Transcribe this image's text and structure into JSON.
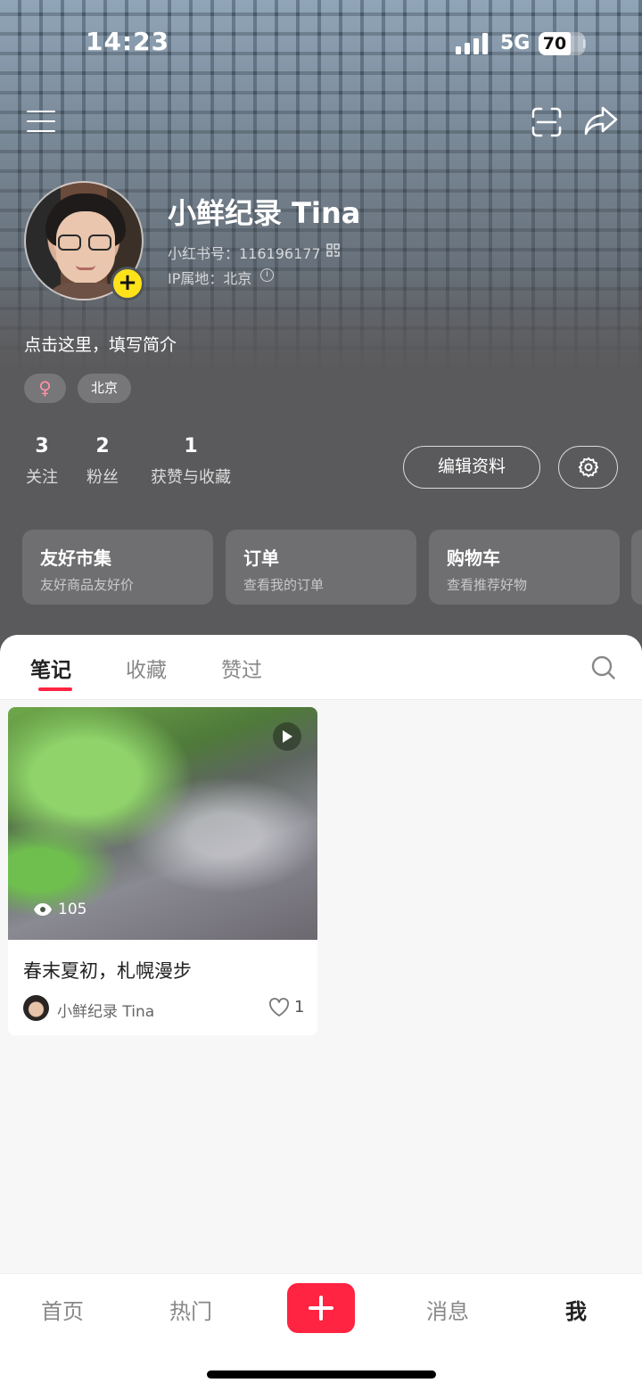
{
  "status_bar": {
    "time": "14:23",
    "network": "5G",
    "battery": "70"
  },
  "profile": {
    "nickname": "小鲜纪录 Tina",
    "redbook_id": "小红书号：116196177",
    "ip_location": "IP属地：北京",
    "bio": "点击这里，填写简介",
    "tags": {
      "gender": "♀",
      "city": "北京"
    }
  },
  "stats": [
    {
      "value": "3",
      "label": "关注"
    },
    {
      "value": "2",
      "label": "粉丝"
    },
    {
      "value": "1",
      "label": "获赞与收藏"
    }
  ],
  "actions": {
    "edit_profile": "编辑资料"
  },
  "services": [
    {
      "title": "友好市集",
      "subtitle": "友好商品友好价"
    },
    {
      "title": "订单",
      "subtitle": "查看我的订单"
    },
    {
      "title": "购物车",
      "subtitle": "查看推荐好物"
    }
  ],
  "tabs": [
    {
      "label": "笔记",
      "active": true
    },
    {
      "label": "收藏",
      "active": false
    },
    {
      "label": "赞过",
      "active": false
    }
  ],
  "notes": [
    {
      "title": "春末夏初，札幌漫步",
      "author": "小鲜纪录 Tina",
      "views": "105",
      "likes": "1",
      "is_video": true
    }
  ],
  "bottom_nav": [
    {
      "label": "首页"
    },
    {
      "label": "热门"
    },
    {
      "label": "消息"
    },
    {
      "label": "我",
      "active": true
    }
  ],
  "colors": {
    "brand_red": "#ff2442",
    "add_badge_yellow": "#ffe21a"
  }
}
